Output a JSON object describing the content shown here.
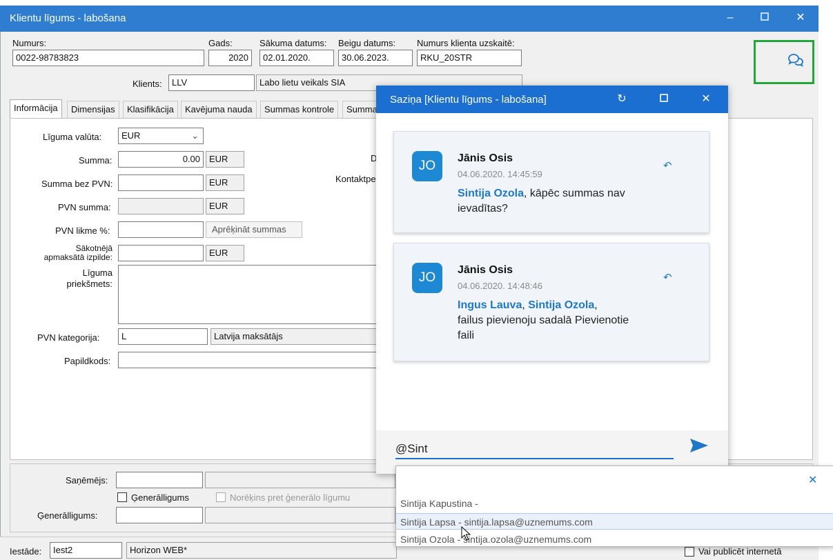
{
  "window": {
    "title": "Klientu līgums - labošana",
    "controls": [
      "minimize-icon",
      "maximize-icon",
      "close-icon"
    ]
  },
  "header": {
    "numurs_label": "Numurs:",
    "numurs": "0022-98783823",
    "gads_label": "Gads:",
    "gads": "2020",
    "sakuma_label": "Sākuma datums:",
    "sakuma": "02.01.2020.",
    "beigu_label": "Beigu datums:",
    "beigu": "30.06.2023.",
    "uzskaite_label": "Numurs klienta uzskaitē:",
    "uzskaite": "RKU_20STR",
    "klients_label": "Klients:",
    "klients_code": "LLV",
    "klients_name": "Labo lietu veikals SIA"
  },
  "tabs": [
    "Informācija",
    "Dimensijas",
    "Klasifikācija",
    "Kavējuma nauda",
    "Summas kontrole",
    "Summa"
  ],
  "form": {
    "valuta_label": "Līguma valūta:",
    "valuta": "EUR",
    "summa_label": "Summa:",
    "summa": "0.00",
    "summa_cur": "EUR",
    "bez_pvn_label": "Summa bez PVN:",
    "bez_pvn_cur": "EUR",
    "pvn_summa_label": "PVN summa:",
    "pvn_summa_cur": "EUR",
    "pvn_likme_label": "PVN likme %:",
    "aprekinat": "Aprēķināt summas",
    "sakotneja_label1": "Sākotnējā",
    "sakotneja_label2": "apmaksātā izpilde:",
    "sakotneja_cur": "EUR",
    "prieksmets_label1": "Līguma",
    "prieksmets_label2": "priekšmets:",
    "pvn_kat_label": "PVN kategorija:",
    "pvn_kat": "L",
    "pvn_kat_name": "Latvija maksātājs",
    "papildkods_label": "Papildkods:",
    "right_label_d": "D",
    "kontakt_label": "Kontaktpe"
  },
  "lower": {
    "sanemejs_label": "Saņēmējs:",
    "general_check": "Ģenerālligums",
    "noreikins_check": "Norēķins pret ģenerālo līgumu",
    "general_label": "Ģenerālligums:"
  },
  "bottom": {
    "iestade_label": "Iestāde:",
    "iestade": "Iest2",
    "iestade_name": "Horizon WEB*",
    "publicet": "Vai publicēt internetā"
  },
  "chat": {
    "title": "Saziņa [Klientu līgums - labošana]",
    "messages": [
      {
        "initials": "JO",
        "author": "Jānis Osis",
        "time": "04.06.2020. 14:45:59",
        "m1": "Sintija Ozola",
        "text1": ", kāpēc summas nav",
        "text2": "ievadītas?"
      },
      {
        "initials": "JO",
        "author": "Jānis Osis",
        "time": "04.06.2020. 14:48:46",
        "m1": "Ingus Lauva",
        "sep": ", ",
        "m2": "Sintija Ozola",
        "tail": ",",
        "text2": "failus pievienoju sadalā Pievienotie",
        "text3": "faili"
      }
    ],
    "input_value": "@Sint"
  },
  "suggestions": [
    "Sintija Kapustina -",
    "Sintija Lapsa - sintija.lapsa@uznemums.com",
    "Sintija Ozola - sintija.ozola@uznemums.com"
  ],
  "colors": {
    "titlebar": "#2e7dd1",
    "chat_titlebar": "#1b6fd0",
    "mention": "#1d78c8",
    "highlight": "#21a63a"
  }
}
